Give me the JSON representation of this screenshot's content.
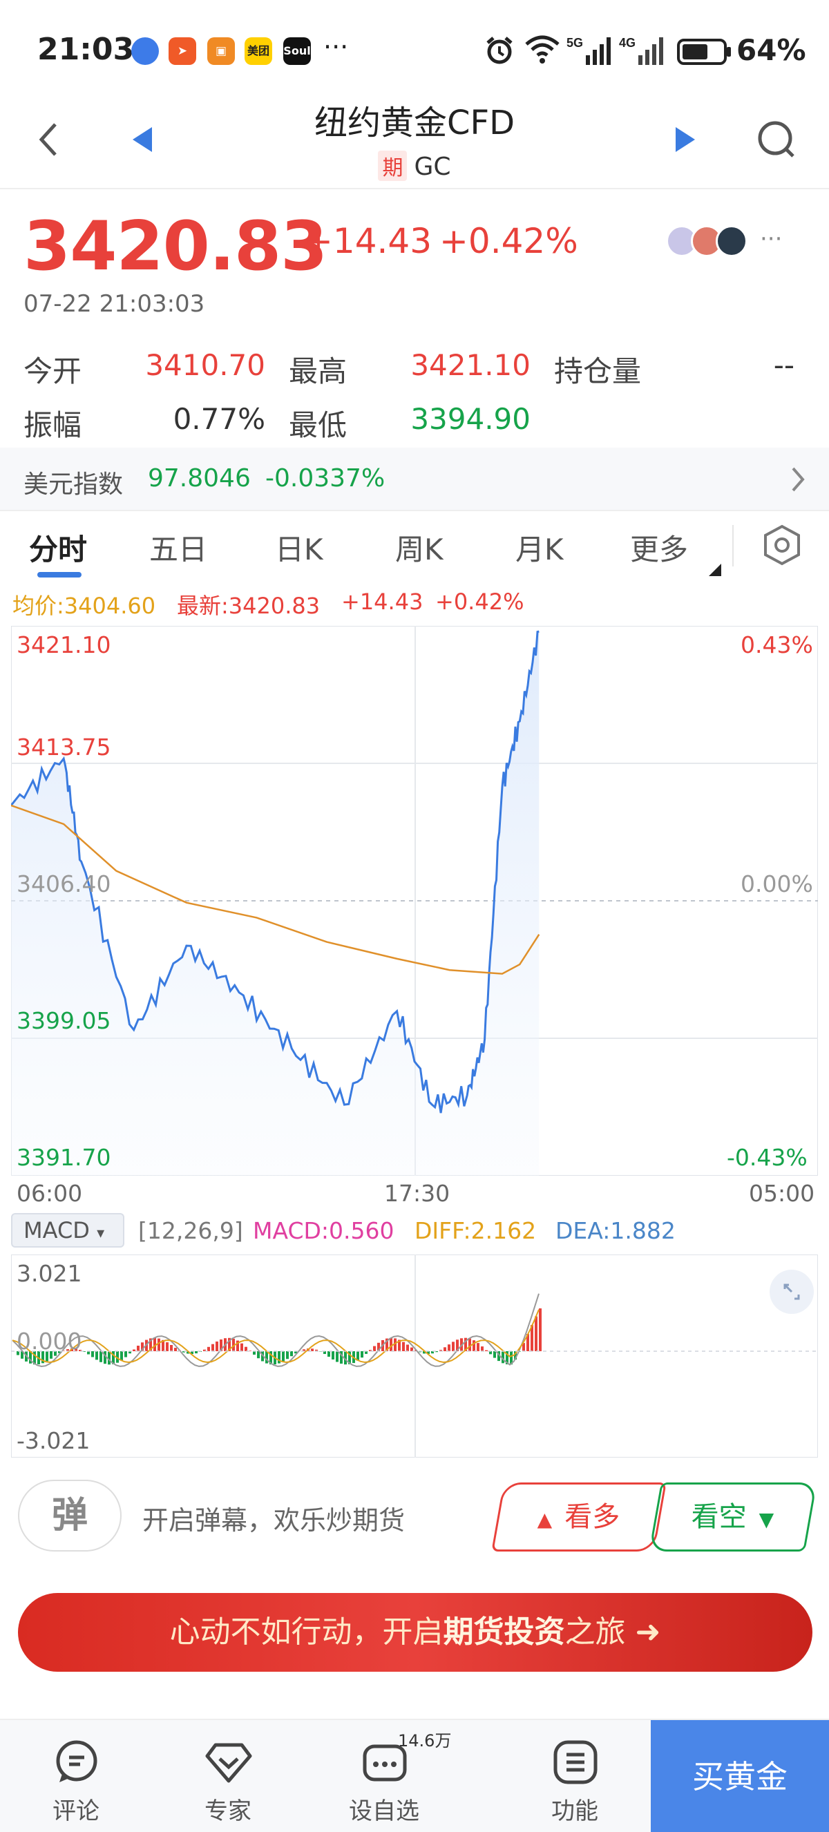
{
  "status_bar": {
    "time": "21:03",
    "app_icons": [
      "browser-icon",
      "paper-plane-app-icon",
      "shopping-app-icon",
      "美团",
      "Soul"
    ],
    "more": "···",
    "network": [
      "5G",
      "4G"
    ],
    "battery": "64%"
  },
  "header": {
    "title": "纽约黄金CFD",
    "badge": "期",
    "code": "GC"
  },
  "quote": {
    "price": "3420.83",
    "change": "+14.43",
    "change_pct": "+0.42%",
    "timestamp": "07-22 21:03:03",
    "more": "···"
  },
  "stats": {
    "open_label": "今开",
    "open": "3410.70",
    "high_label": "最高",
    "high": "3421.10",
    "oi_label": "持仓量",
    "oi": "--",
    "amp_label": "振幅",
    "amp": "0.77%",
    "low_label": "最低",
    "low": "3394.90"
  },
  "usd_index": {
    "label": "美元指数",
    "value": "97.8046",
    "change": "-0.0337%"
  },
  "tabs": [
    "分时",
    "五日",
    "日K",
    "周K",
    "月K",
    "更多"
  ],
  "chart_info": {
    "avg": "均价:3404.60",
    "latest": "最新:3420.83",
    "change": "+14.43",
    "pct": "+0.42%"
  },
  "chart_axes": {
    "y_left": [
      "3421.10",
      "3413.75",
      "3406.40",
      "3399.05",
      "3391.70"
    ],
    "y_right": [
      "0.43%",
      "0.00%",
      "-0.43%"
    ],
    "x": [
      "06:00",
      "17:30",
      "05:00"
    ]
  },
  "macd": {
    "button": "MACD",
    "params": "[12,26,9]",
    "macd": "MACD:0.560",
    "diff": "DIFF:2.162",
    "dea": "DEA:1.882",
    "y": [
      "3.021",
      "0.000",
      "-3.021"
    ]
  },
  "colors": {
    "red": "#e8413b",
    "green": "#16a34a",
    "blue": "#3a7be0",
    "avg": "#e0902a",
    "macd": "#e03fa0",
    "diff": "#e3a21a",
    "dea": "#4a86c8"
  },
  "interact": {
    "danmu": "弹",
    "danmu_text": "开启弹幕，欢乐炒期货",
    "bull": "看多",
    "bear": "看空"
  },
  "promo": {
    "part1": "心动不如行动，开启",
    "part2": "期货投资",
    "part3": "之旅 ➜"
  },
  "bottom_nav": {
    "comment": "评论",
    "expert": "专家",
    "watch": "设自选",
    "watch_badge": "14.6万",
    "function": "功能",
    "buy": "买黄金"
  },
  "chart_data": {
    "type": "line",
    "title": "",
    "x_range": [
      "06:00",
      "05:00"
    ],
    "ylim": [
      3391.7,
      3421.1
    ],
    "reference": 3406.4,
    "series": [
      {
        "name": "",
        "x": [
          "06:00",
          "07:30",
          "08:00",
          "09:30",
          "11:00",
          "12:30",
          "14:00",
          "15:30",
          "17:00",
          "18:00",
          "19:00",
          "19:30",
          "20:00",
          "20:30",
          "21:03"
        ],
        "values": [
          3411.5,
          3414.0,
          3408.5,
          3399.5,
          3404.0,
          3401.5,
          3398.5,
          3395.5,
          3400.5,
          3395.5,
          3396.0,
          3399.0,
          3412.5,
          3416.0,
          3420.8
        ]
      },
      {
        "name": "均价",
        "x": [
          "06:00",
          "07:30",
          "09:00",
          "11:00",
          "13:00",
          "15:00",
          "17:00",
          "18:30",
          "20:00",
          "20:30",
          "21:03"
        ],
        "values": [
          3411.5,
          3410.5,
          3408.0,
          3406.3,
          3405.5,
          3404.2,
          3403.3,
          3402.7,
          3402.5,
          3403.0,
          3404.6
        ]
      }
    ]
  }
}
